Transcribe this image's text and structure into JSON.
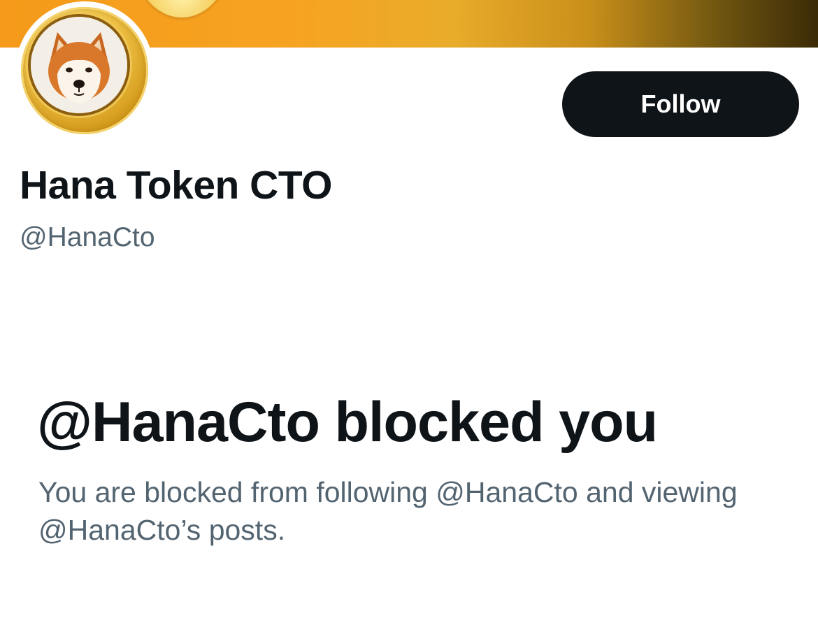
{
  "profile": {
    "display_name": "Hana Token CTO",
    "handle": "@HanaCto",
    "avatar": "shiba-inu-gold-coin",
    "banner_colors": [
      "#f59a1a",
      "#e9ac2a",
      "#3a2a06"
    ]
  },
  "actions": {
    "follow_label": "Follow"
  },
  "blocked_notice": {
    "title": "@HanaCto blocked you",
    "description": "You are blocked from following @HanaCto and viewing @HanaCto’s posts."
  },
  "colors": {
    "primary_text": "#0f1419",
    "secondary_text": "#536471",
    "button_bg": "#0f1419",
    "button_text": "#ffffff"
  }
}
